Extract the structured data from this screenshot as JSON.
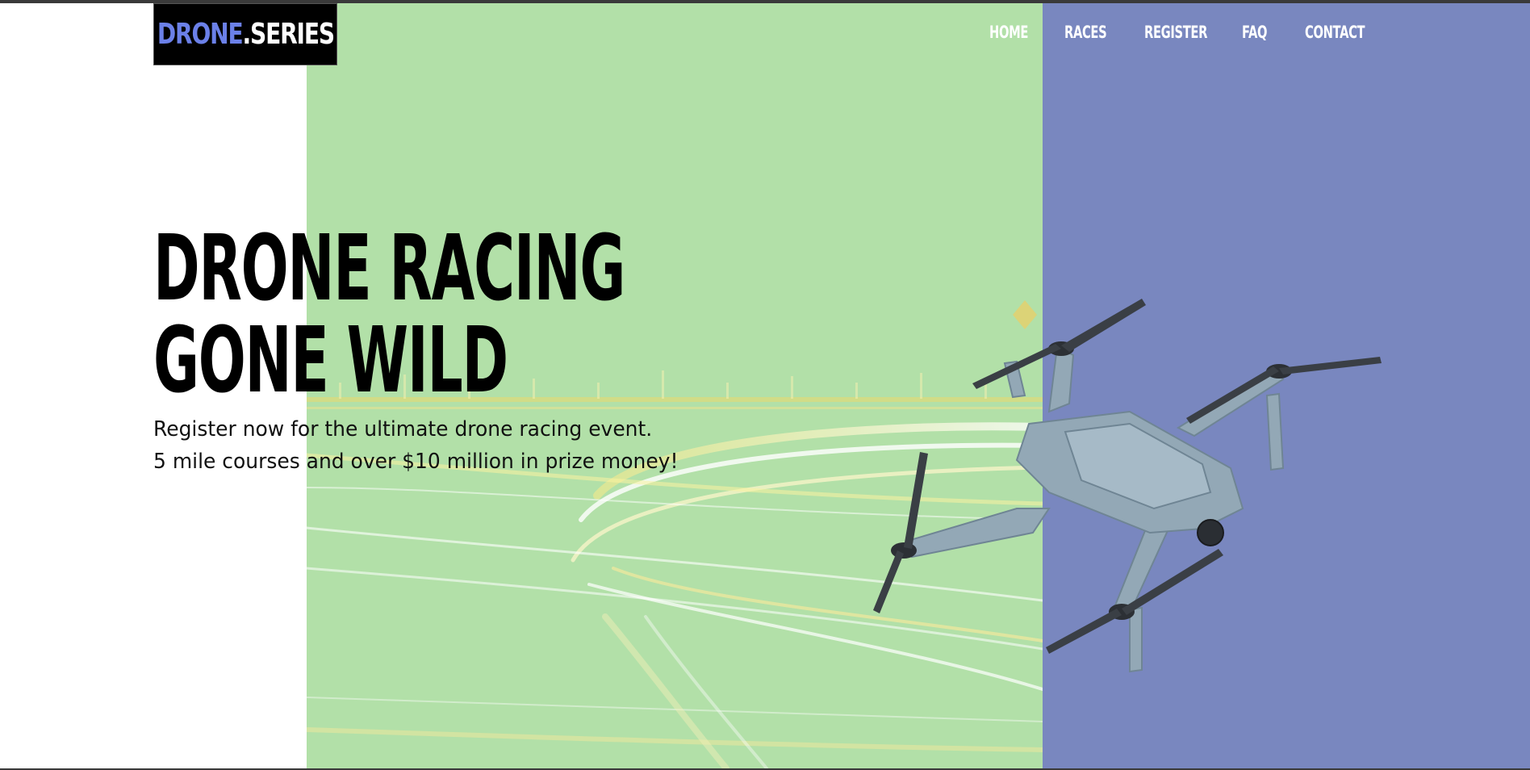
{
  "logo": {
    "part_a": "DRONE",
    "part_b": ".SERIES"
  },
  "nav": {
    "items": [
      {
        "label": "HOME"
      },
      {
        "label": "RACES"
      },
      {
        "label": "REGISTER"
      },
      {
        "label": "FAQ"
      },
      {
        "label": "CONTACT"
      }
    ]
  },
  "hero": {
    "headline_line1": "DRONE RACING",
    "headline_line2": "GONE WILD",
    "sub_line1": "Register now for the ultimate drone racing event.",
    "sub_line2": "5 mile courses and over $10 million in prize money!",
    "image_subject": "drone-icon",
    "background_subject": "light-trails"
  },
  "colors": {
    "accent_blue": "#6b80e8",
    "panel_green": "#b2e0a8",
    "panel_blue": "#7987bf",
    "text_dark": "#000000",
    "nav_text": "#ffffff"
  }
}
